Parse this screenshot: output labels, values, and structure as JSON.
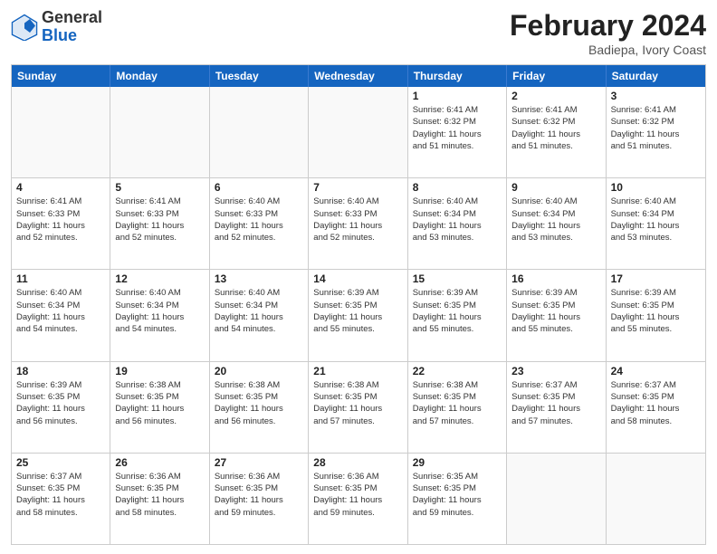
{
  "header": {
    "logo_general": "General",
    "logo_blue": "Blue",
    "title": "February 2024",
    "location": "Badiepa, Ivory Coast"
  },
  "days_of_week": [
    "Sunday",
    "Monday",
    "Tuesday",
    "Wednesday",
    "Thursday",
    "Friday",
    "Saturday"
  ],
  "weeks": [
    [
      {
        "day": "",
        "info": ""
      },
      {
        "day": "",
        "info": ""
      },
      {
        "day": "",
        "info": ""
      },
      {
        "day": "",
        "info": ""
      },
      {
        "day": "1",
        "info": "Sunrise: 6:41 AM\nSunset: 6:32 PM\nDaylight: 11 hours\nand 51 minutes."
      },
      {
        "day": "2",
        "info": "Sunrise: 6:41 AM\nSunset: 6:32 PM\nDaylight: 11 hours\nand 51 minutes."
      },
      {
        "day": "3",
        "info": "Sunrise: 6:41 AM\nSunset: 6:32 PM\nDaylight: 11 hours\nand 51 minutes."
      }
    ],
    [
      {
        "day": "4",
        "info": "Sunrise: 6:41 AM\nSunset: 6:33 PM\nDaylight: 11 hours\nand 52 minutes."
      },
      {
        "day": "5",
        "info": "Sunrise: 6:41 AM\nSunset: 6:33 PM\nDaylight: 11 hours\nand 52 minutes."
      },
      {
        "day": "6",
        "info": "Sunrise: 6:40 AM\nSunset: 6:33 PM\nDaylight: 11 hours\nand 52 minutes."
      },
      {
        "day": "7",
        "info": "Sunrise: 6:40 AM\nSunset: 6:33 PM\nDaylight: 11 hours\nand 52 minutes."
      },
      {
        "day": "8",
        "info": "Sunrise: 6:40 AM\nSunset: 6:34 PM\nDaylight: 11 hours\nand 53 minutes."
      },
      {
        "day": "9",
        "info": "Sunrise: 6:40 AM\nSunset: 6:34 PM\nDaylight: 11 hours\nand 53 minutes."
      },
      {
        "day": "10",
        "info": "Sunrise: 6:40 AM\nSunset: 6:34 PM\nDaylight: 11 hours\nand 53 minutes."
      }
    ],
    [
      {
        "day": "11",
        "info": "Sunrise: 6:40 AM\nSunset: 6:34 PM\nDaylight: 11 hours\nand 54 minutes."
      },
      {
        "day": "12",
        "info": "Sunrise: 6:40 AM\nSunset: 6:34 PM\nDaylight: 11 hours\nand 54 minutes."
      },
      {
        "day": "13",
        "info": "Sunrise: 6:40 AM\nSunset: 6:34 PM\nDaylight: 11 hours\nand 54 minutes."
      },
      {
        "day": "14",
        "info": "Sunrise: 6:39 AM\nSunset: 6:35 PM\nDaylight: 11 hours\nand 55 minutes."
      },
      {
        "day": "15",
        "info": "Sunrise: 6:39 AM\nSunset: 6:35 PM\nDaylight: 11 hours\nand 55 minutes."
      },
      {
        "day": "16",
        "info": "Sunrise: 6:39 AM\nSunset: 6:35 PM\nDaylight: 11 hours\nand 55 minutes."
      },
      {
        "day": "17",
        "info": "Sunrise: 6:39 AM\nSunset: 6:35 PM\nDaylight: 11 hours\nand 55 minutes."
      }
    ],
    [
      {
        "day": "18",
        "info": "Sunrise: 6:39 AM\nSunset: 6:35 PM\nDaylight: 11 hours\nand 56 minutes."
      },
      {
        "day": "19",
        "info": "Sunrise: 6:38 AM\nSunset: 6:35 PM\nDaylight: 11 hours\nand 56 minutes."
      },
      {
        "day": "20",
        "info": "Sunrise: 6:38 AM\nSunset: 6:35 PM\nDaylight: 11 hours\nand 56 minutes."
      },
      {
        "day": "21",
        "info": "Sunrise: 6:38 AM\nSunset: 6:35 PM\nDaylight: 11 hours\nand 57 minutes."
      },
      {
        "day": "22",
        "info": "Sunrise: 6:38 AM\nSunset: 6:35 PM\nDaylight: 11 hours\nand 57 minutes."
      },
      {
        "day": "23",
        "info": "Sunrise: 6:37 AM\nSunset: 6:35 PM\nDaylight: 11 hours\nand 57 minutes."
      },
      {
        "day": "24",
        "info": "Sunrise: 6:37 AM\nSunset: 6:35 PM\nDaylight: 11 hours\nand 58 minutes."
      }
    ],
    [
      {
        "day": "25",
        "info": "Sunrise: 6:37 AM\nSunset: 6:35 PM\nDaylight: 11 hours\nand 58 minutes."
      },
      {
        "day": "26",
        "info": "Sunrise: 6:36 AM\nSunset: 6:35 PM\nDaylight: 11 hours\nand 58 minutes."
      },
      {
        "day": "27",
        "info": "Sunrise: 6:36 AM\nSunset: 6:35 PM\nDaylight: 11 hours\nand 59 minutes."
      },
      {
        "day": "28",
        "info": "Sunrise: 6:36 AM\nSunset: 6:35 PM\nDaylight: 11 hours\nand 59 minutes."
      },
      {
        "day": "29",
        "info": "Sunrise: 6:35 AM\nSunset: 6:35 PM\nDaylight: 11 hours\nand 59 minutes."
      },
      {
        "day": "",
        "info": ""
      },
      {
        "day": "",
        "info": ""
      }
    ]
  ]
}
